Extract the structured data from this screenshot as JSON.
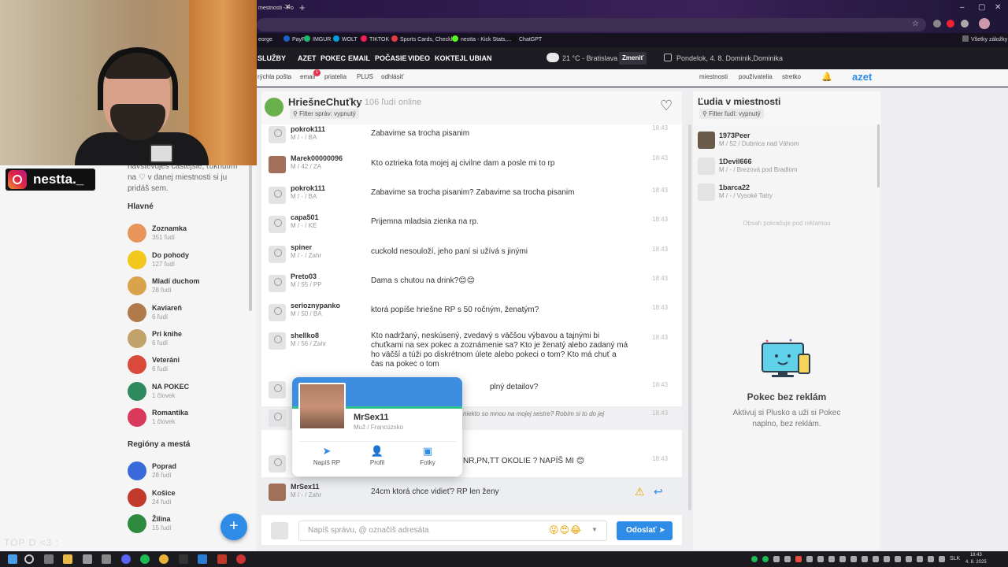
{
  "browser": {
    "tab_title": "mestnosti - Po",
    "bookmarks": [
      "eorge",
      "PayPal",
      "IMGUR",
      "WOLT",
      "TIKTOK",
      "Sports Cards, Checkl...",
      "nestta - Kick Stats,...",
      "ChatGPT",
      "Všetky záložky"
    ]
  },
  "site_nav": {
    "items": [
      "SLUŽBY",
      "AZET",
      "POKEC",
      "EMAIL",
      "POČASIE",
      "VIDEO",
      "KOKTEJL",
      "UBIAN"
    ],
    "weather": "21 °C - Bratislava",
    "change_label": "Zmeniť",
    "date": "Pondelok, 4. 8. Dominik,Dominika"
  },
  "sub_nav": {
    "left": [
      "rýchla pošta",
      "email",
      "priatelia",
      "PLUS",
      "odhlásiť"
    ],
    "email_badge": "1",
    "right": [
      "miestnosti",
      "používatelia",
      "stretko"
    ],
    "logo": "azet"
  },
  "left_panel": {
    "intro": "navštevuješ častejšie, ťuknutím na ♡ v danej miestnosti si ju pridáš sem.",
    "main_title": "Hlavné",
    "main_rooms": [
      {
        "name": "Zoznamka",
        "count": "351 ľudí",
        "color": "#e8945a"
      },
      {
        "name": "Do pohody",
        "count": "127 ľudí",
        "color": "#f2c81f"
      },
      {
        "name": "Mladí duchom",
        "count": "28 ľudí",
        "color": "#d9a34c"
      },
      {
        "name": "Kaviareň",
        "count": "6 ľudí",
        "color": "#b07a4a"
      },
      {
        "name": "Pri knihe",
        "count": "6 ľudí",
        "color": "#c2a26b"
      },
      {
        "name": "Veteráni",
        "count": "6 ľudí",
        "color": "#d94a3a"
      },
      {
        "name": "NA POKEC",
        "count": "1 človek",
        "color": "#2e8a5e"
      },
      {
        "name": "Romantika",
        "count": "1 človek",
        "color": "#d9395a"
      }
    ],
    "regions_title": "Regióny a mestá",
    "regions": [
      {
        "name": "Poprad",
        "count": "28 ľudí",
        "color": "#3a6ad9"
      },
      {
        "name": "Košice",
        "count": "24 ľudí",
        "color": "#c0392b"
      },
      {
        "name": "Žilina",
        "count": "15 ľudí",
        "color": "#2e8a3e"
      }
    ]
  },
  "overlay": {
    "instagram_handle": "nestta._",
    "bottom_text": "TOP D <3 :"
  },
  "chat": {
    "room_name": "HriešneChuťky",
    "online": "• 106 ľudí online",
    "filter_label": "Filter správ: vypnutý",
    "messages": [
      {
        "nick": "pokrok111",
        "meta": "M / - / BA",
        "text": "Zabavime sa trocha pisanim",
        "time": "18:43"
      },
      {
        "nick": "Marek00000096",
        "meta": "M / 42 / ZA",
        "text": "Kto oztrieka fota mojej aj civilne dam a posle mi to rp",
        "time": "18:43"
      },
      {
        "nick": "pokrok111",
        "meta": "M / - / BA",
        "text": "Zabavime sa trocha pisanim? Zabavime sa trocha pisanim",
        "time": "18:43"
      },
      {
        "nick": "capa501",
        "meta": "M / - / KE",
        "text": "Prijemna mladsia zienka na rp.",
        "time": "18:43"
      },
      {
        "nick": "spiner",
        "meta": "M / - / Zahr",
        "text": "cuckold nesouloží, jeho paní si užívá s jinými",
        "time": "18:43"
      },
      {
        "nick": "Preto03",
        "meta": "M / 55 / PP",
        "text": "Dama s chutou na drink?😊😊",
        "time": "18:43"
      },
      {
        "nick": "serioznypanko",
        "meta": "M / 50 / BA",
        "text": "ktorá popíše hriešne RP s 50 ročným, ženatým?",
        "time": "18:43"
      },
      {
        "nick": "shellko8",
        "meta": "M / 56 / Zahr",
        "text": "Kto nadržaný, neskúsený, zvedavý s väčšou výbavou a tajnými bi chuťkami na sex pokec a zoznámenie sa? Kto je ženatý alebo zadaný má ho väčší a túži po diskrétnom úlete alebo pokeci o tom? Kto má chuť a čas na pokec o tom",
        "time": "18:43"
      },
      {
        "nick": "",
        "meta": "",
        "text": "plný detailov?",
        "time": "18:43"
      },
      {
        "nick": "",
        "meta": "",
        "text": "niekto so mnou na mojej sestre? Robím si to do jej",
        "time": "18:43"
      },
      {
        "nick": "",
        "meta": "",
        "text": "NR,PN,TT OKOLIE ? NAPÍŠ MI 😊",
        "time": "18:43"
      },
      {
        "nick": "MrSex11",
        "meta": "M / - / Zahr",
        "text": "24cm ktorá chce vidieť? RP len ženy",
        "time": ""
      }
    ],
    "composer_placeholder": "Napíš správu, @ označíš adresáta",
    "emojis": "😜😍😂",
    "send_label": "Odoslať"
  },
  "popup": {
    "name": "MrSex11",
    "meta": "Muž / Francúzsko",
    "actions": [
      "Napíš RP",
      "Profil",
      "Fotky"
    ]
  },
  "people": {
    "title": "Ľudia v miestnosti",
    "filter_label": "Filter ľudí: vypnutý",
    "list": [
      {
        "name": "1973Peer",
        "meta": "M / 52 / Dubnica nad Váhom"
      },
      {
        "name": "1Devil666",
        "meta": "M / - / Brezová pod Bradlom"
      },
      {
        "name": "1barca22",
        "meta": "M / - / Vysoké Tatry"
      }
    ],
    "ad_note": "Obsah pokračuje pod reklamou",
    "promo_title": "Pokec bez reklám",
    "promo_text": "Aktivuj si Plusko a uži si Pokec naplno, bez reklám."
  },
  "taskbar": {
    "lang": "SLK",
    "time": "18:43",
    "date": "4. 8. 2025"
  },
  "colors": {
    "accent": "#2e8be6",
    "warn": "#e6a100"
  }
}
